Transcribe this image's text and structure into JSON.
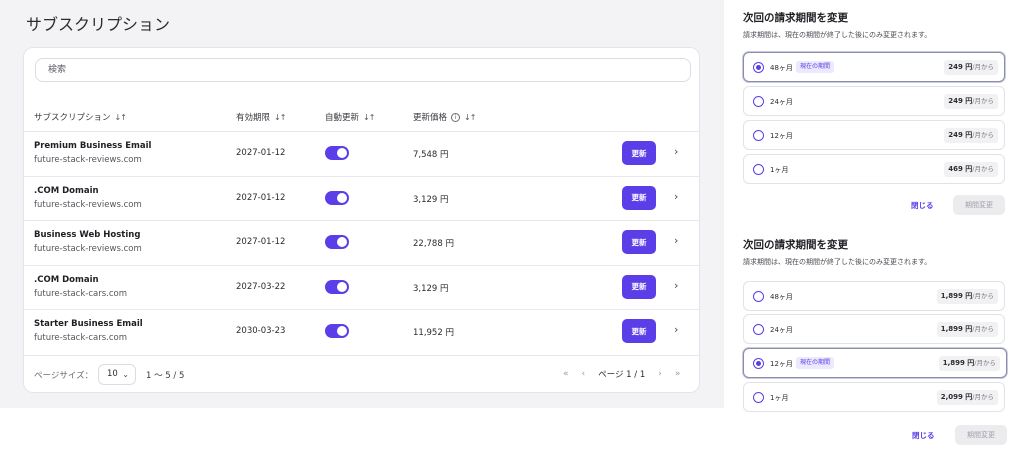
{
  "page_title": "サブスクリプション",
  "search": {
    "placeholder": "検索"
  },
  "table": {
    "headers": {
      "subscription": "サブスクリプション",
      "expiry": "有効期限",
      "auto_renew": "自動更新",
      "renew_price": "更新価格",
      "sort_icon": "↓↑",
      "info_icon": "i"
    },
    "rows": [
      {
        "name": "Premium Business Email",
        "domain": "future-stack-reviews.com",
        "expiry": "2027-01-12",
        "auto_renew": true,
        "price": "7,548 円",
        "action": "更新"
      },
      {
        "name": ".COM Domain",
        "domain": "future-stack-reviews.com",
        "expiry": "2027-01-12",
        "auto_renew": true,
        "price": "3,129 円",
        "action": "更新"
      },
      {
        "name": "Business Web Hosting",
        "domain": "future-stack-reviews.com",
        "expiry": "2027-01-12",
        "auto_renew": true,
        "price": "22,788 円",
        "action": "更新"
      },
      {
        "name": ".COM Domain",
        "domain": "future-stack-cars.com",
        "expiry": "2027-03-22",
        "auto_renew": true,
        "price": "3,129 円",
        "action": "更新"
      },
      {
        "name": "Starter Business Email",
        "domain": "future-stack-cars.com",
        "expiry": "2030-03-23",
        "auto_renew": true,
        "price": "11,952 円",
        "action": "更新"
      }
    ]
  },
  "footer": {
    "page_size_label": "ページサイズ：",
    "page_size": "10",
    "range": "1 〜 5 / 5",
    "page_label": "ページ 1 / 1",
    "first": "«",
    "prev": "‹",
    "next": "›",
    "last": "»"
  },
  "panels": [
    {
      "title": "次回の請求期間を変更",
      "description": "請求期間は、現在の期間が終了した後にのみ変更されます。",
      "options": [
        {
          "label": "48ヶ月",
          "badge": "現在の期間",
          "price": "249 円",
          "unit": "/月から",
          "selected": true
        },
        {
          "label": "24ヶ月",
          "badge": "",
          "price": "249 円",
          "unit": "/月から",
          "selected": false
        },
        {
          "label": "12ヶ月",
          "badge": "",
          "price": "249 円",
          "unit": "/月から",
          "selected": false
        },
        {
          "label": "1ヶ月",
          "badge": "",
          "price": "469 円",
          "unit": "/月から",
          "selected": false
        }
      ],
      "close_label": "閉じる",
      "change_label": "期間変更"
    },
    {
      "title": "次回の請求期間を変更",
      "description": "請求期間は、現在の期間が終了した後にのみ変更されます。",
      "options": [
        {
          "label": "48ヶ月",
          "badge": "",
          "price": "1,899 円",
          "unit": "/月から",
          "selected": false
        },
        {
          "label": "24ヶ月",
          "badge": "",
          "price": "1,899 円",
          "unit": "/月から",
          "selected": false
        },
        {
          "label": "12ヶ月",
          "badge": "現在の期間",
          "price": "1,899 円",
          "unit": "/月から",
          "selected": true
        },
        {
          "label": "1ヶ月",
          "badge": "",
          "price": "2,099 円",
          "unit": "/月から",
          "selected": false
        }
      ],
      "close_label": "閉じる",
      "change_label": "期間変更"
    }
  ],
  "colors": {
    "accent": "#5b3ee8",
    "badge_bg": "#ece8fd",
    "page_bg": "#f3f3f6"
  },
  "icons": {
    "chevron_right": "chevron-right-icon",
    "chevron_down": "chevron-down-icon",
    "sort": "sort-icon",
    "info": "info-icon"
  }
}
